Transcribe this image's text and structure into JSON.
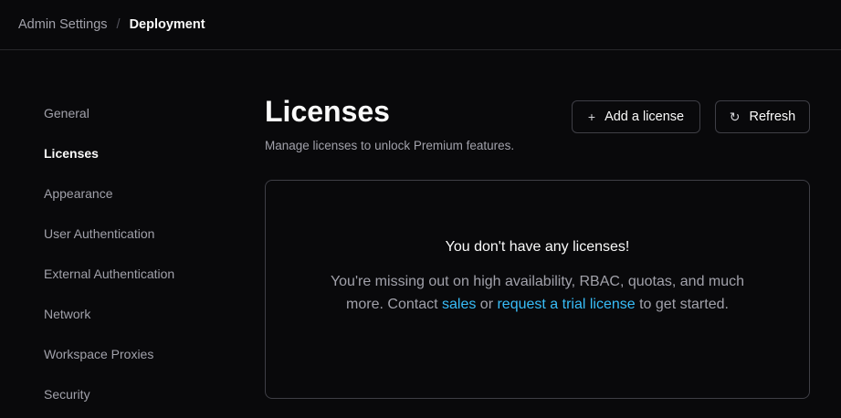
{
  "breadcrumb": {
    "parent": "Admin Settings",
    "separator": "/",
    "current": "Deployment"
  },
  "sidebar": {
    "items": [
      {
        "label": "General"
      },
      {
        "label": "Licenses",
        "active": true
      },
      {
        "label": "Appearance"
      },
      {
        "label": "User Authentication"
      },
      {
        "label": "External Authentication"
      },
      {
        "label": "Network"
      },
      {
        "label": "Workspace Proxies"
      },
      {
        "label": "Security"
      }
    ]
  },
  "page": {
    "title": "Licenses",
    "subtitle": "Manage licenses to unlock Premium features.",
    "add_label": "Add a license",
    "refresh_label": "Refresh"
  },
  "empty": {
    "title": "You don't have any licenses!",
    "text1": "You're missing out on high availability, RBAC, quotas, and much more. Contact ",
    "link1": "sales",
    "text2": " or ",
    "link2": "request a trial license",
    "text3": " to get started."
  },
  "colors": {
    "background": "#09090b",
    "link": "#38bdf8"
  }
}
